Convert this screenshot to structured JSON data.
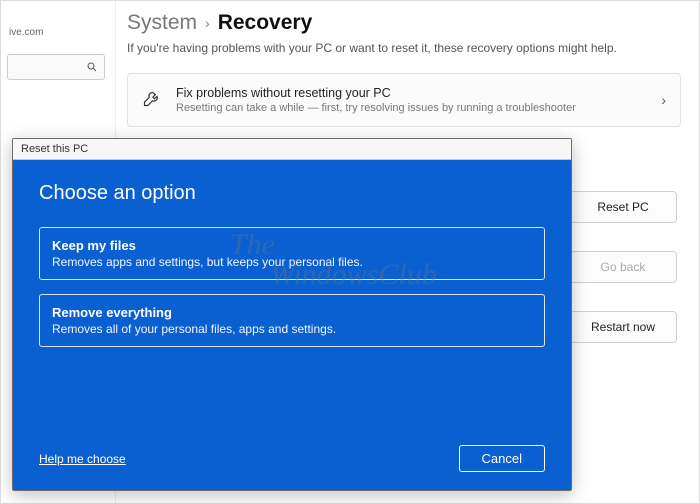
{
  "sidebar": {
    "emailFragment": "ive.com"
  },
  "breadcrumb": {
    "parent": "System",
    "current": "Recovery"
  },
  "intro": "If you're having problems with your PC or want to reset it, these recovery options might help.",
  "fixCard": {
    "title": "Fix problems without resetting your PC",
    "desc": "Resetting can take a while — first, try resolving issues by running a troubleshooter"
  },
  "buttons": {
    "reset": "Reset PC",
    "goback": "Go back",
    "restart": "Restart now"
  },
  "dialog": {
    "windowTitle": "Reset this PC",
    "heading": "Choose an option",
    "options": [
      {
        "title": "Keep my files",
        "desc": "Removes apps and settings, but keeps your personal files."
      },
      {
        "title": "Remove everything",
        "desc": "Removes all of your personal files, apps and settings."
      }
    ],
    "help": "Help me choose",
    "cancel": "Cancel"
  },
  "watermark": {
    "l1": "The",
    "l2": "WindowsClub"
  }
}
